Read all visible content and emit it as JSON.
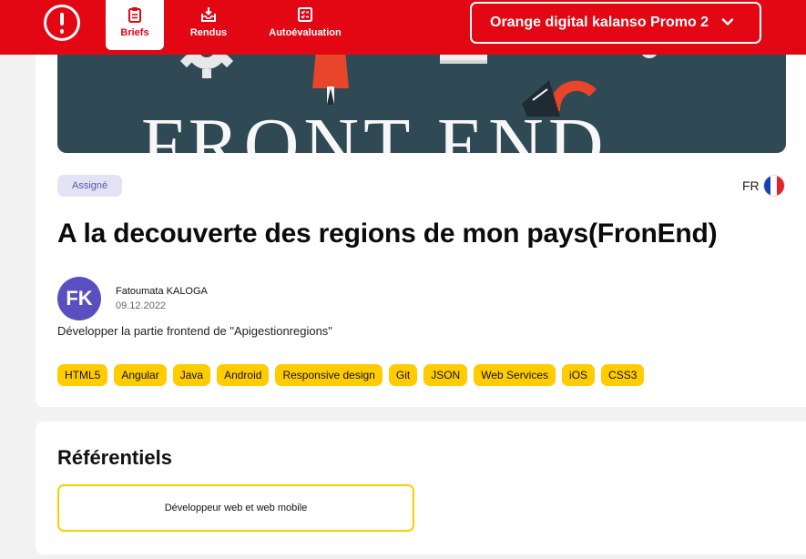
{
  "nav": {
    "items": [
      {
        "label": "Briefs",
        "icon": "clipboard-icon",
        "active": true
      },
      {
        "label": "Rendus",
        "icon": "inbox-download-icon",
        "active": false
      },
      {
        "label": "Autoévaluation",
        "icon": "checklist-icon",
        "active": false
      }
    ],
    "promo_select": "Orange digital kalanso Promo 2"
  },
  "brief": {
    "banner_text": "FRONT END",
    "status": "Assigné",
    "lang": "FR",
    "title": "A la decouverte des regions de mon pays(FronEnd)",
    "author_initials": "FK",
    "author": "Fatoumata KALOGA",
    "date": "09.12.2022",
    "description": "Développer la partie frontend de \"Apigestionregions\"",
    "tags": [
      "HTML5",
      "Angular",
      "Java",
      "Android",
      "Responsive design",
      "Git",
      "JSON",
      "Web Services",
      "iOS",
      "CSS3"
    ]
  },
  "referentiels": {
    "title": "Référentiels",
    "items": [
      "Développeur web et web mobile"
    ]
  },
  "colors": {
    "brand_red": "#e30613",
    "tag_yellow": "#ffcc00",
    "avatar_purple": "#5a4fc0",
    "badge_bg": "#e4e2f5",
    "banner_bg": "#2f4a55"
  }
}
